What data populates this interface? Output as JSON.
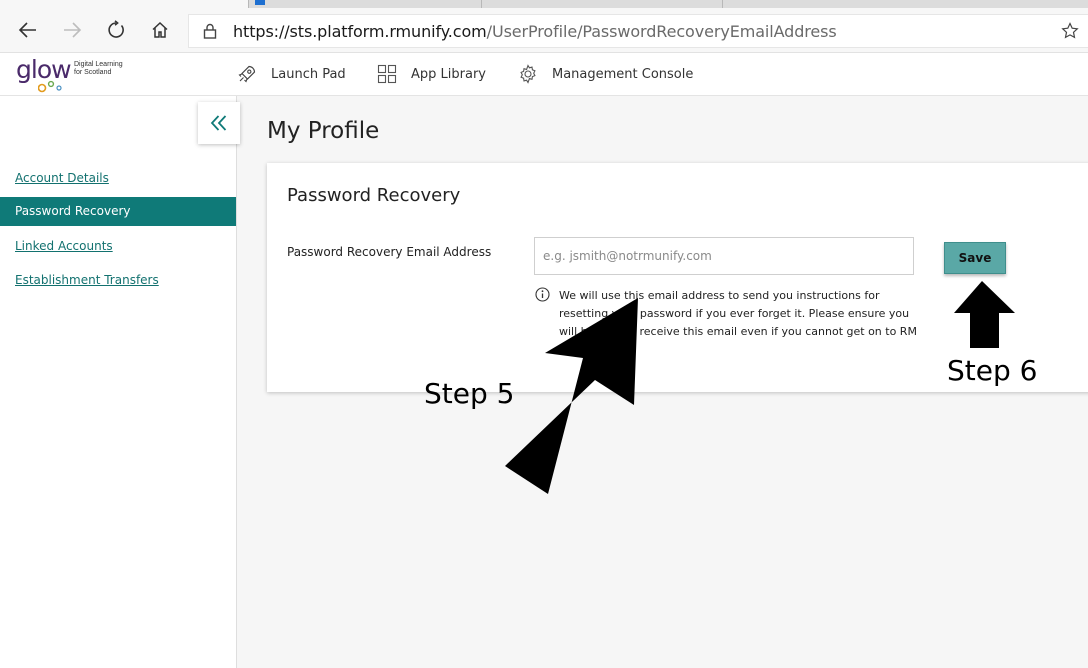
{
  "browser": {
    "url_host": "https://sts.platform.rmunify.com",
    "url_path": "/UserProfile/PasswordRecoveryEmailAddress"
  },
  "app": {
    "logo_word": "glow",
    "logo_sub_line1": "Digital Learning",
    "logo_sub_line2": "for Scotland",
    "nav": [
      {
        "label": "Launch Pad",
        "icon": "rocket-icon"
      },
      {
        "label": "App Library",
        "icon": "grid-icon"
      },
      {
        "label": "Management Console",
        "icon": "gear-icon"
      }
    ]
  },
  "sidebar": {
    "items": [
      {
        "label": "Account Details",
        "active": false
      },
      {
        "label": "Password Recovery",
        "active": true
      },
      {
        "label": "Linked Accounts",
        "active": false
      },
      {
        "label": "Establishment Transfers",
        "active": false
      }
    ]
  },
  "main": {
    "title": "My Profile",
    "card": {
      "title": "Password Recovery",
      "field_label": "Password Recovery Email Address",
      "input_value": "",
      "input_placeholder": "e.g. jsmith@notrmunify.com",
      "info_text": "We will use this email address to send you instructions for resetting your password if you ever forget it. Please ensure you will be able to receive this email even if you cannot get on to RM",
      "save_label": "Save"
    }
  },
  "annotations": {
    "step5": "Step 5",
    "step6": "Step 6"
  },
  "colors": {
    "accent": "#0f7a78",
    "save_button": "#5aa8a6",
    "logo_purple": "#4a2a6a"
  }
}
